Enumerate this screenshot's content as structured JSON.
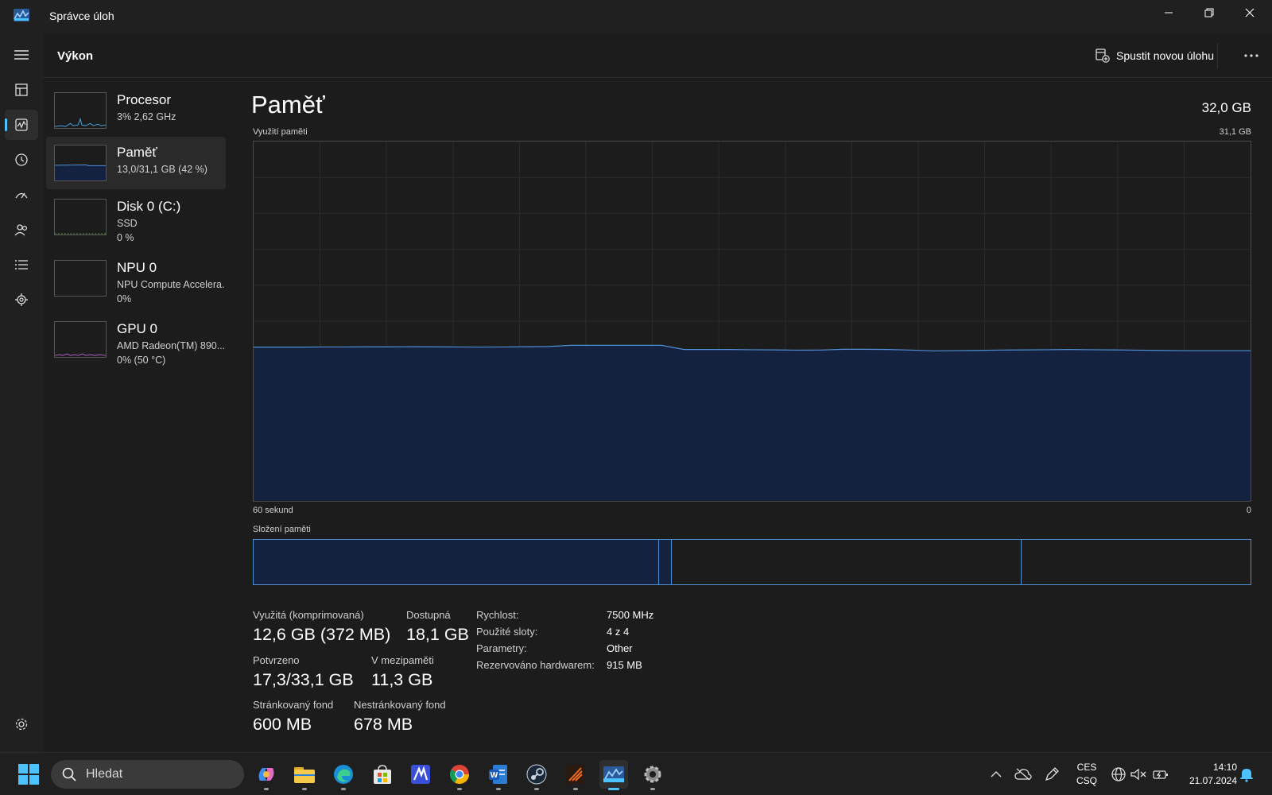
{
  "window": {
    "title": "Správce úloh"
  },
  "header": {
    "title": "Výkon",
    "run_task_label": "Spustit novou úlohu"
  },
  "resources": [
    {
      "name": "Procesor",
      "line1": "3%  2,62 GHz",
      "line2": ""
    },
    {
      "name": "Paměť",
      "line1": "13,0/31,1 GB (42 %)",
      "line2": ""
    },
    {
      "name": "Disk 0 (C:)",
      "line1": "SSD",
      "line2": "0 %"
    },
    {
      "name": "NPU 0",
      "line1": "NPU Compute Accelera.",
      "line2": "0%"
    },
    {
      "name": "GPU 0",
      "line1": "AMD Radeon(TM) 890...",
      "line2": "0%  (50 °C)"
    }
  ],
  "memory": {
    "title": "Paměť",
    "total": "32,0 GB",
    "usage_label": "Využití paměti",
    "usage_max": "31,1 GB",
    "time_left": "60 sekund",
    "time_right": "0",
    "composition_label": "Složení paměti",
    "composition_fractions": {
      "in_use": 0.407,
      "modified": 0.013,
      "standby": 0.351,
      "free": 0.229
    },
    "stats": {
      "used_label": "Využitá (komprimovaná)",
      "used_value": "12,6 GB (372 MB)",
      "available_label": "Dostupná",
      "available_value": "18,1 GB",
      "committed_label": "Potvrzeno",
      "committed_value": "17,3/33,1 GB",
      "cached_label": "V mezipaměti",
      "cached_value": "11,3 GB",
      "paged_label": "Stránkovaný fond",
      "paged_value": "600 MB",
      "nonpaged_label": "Nestránkovaný fond",
      "nonpaged_value": "678 MB"
    },
    "specs": {
      "speed_label": "Rychlost:",
      "speed_value": "7500 MHz",
      "slots_label": "Použité sloty:",
      "slots_value": "4 z 4",
      "form_label": "Parametry:",
      "form_value": "Other",
      "reserved_label": "Rezervováno hardwarem:",
      "reserved_value": "915 MB"
    }
  },
  "chart_data": {
    "type": "area",
    "title": "Využití paměti",
    "xlabel": "",
    "ylabel": "",
    "x_range_labels": [
      "60 sekund",
      "0"
    ],
    "ylim": [
      0,
      31.1
    ],
    "series": [
      {
        "values": [
          13.3,
          13.3,
          13.3,
          13.32,
          13.32,
          13.33,
          13.33,
          13.34,
          13.33,
          13.32,
          13.31,
          13.32,
          13.34,
          13.36,
          13.46,
          13.46,
          13.46,
          13.46,
          13.46,
          13.1,
          13.1,
          13.1,
          13.08,
          13.06,
          13.04,
          13.05,
          13.12,
          13.12,
          13.1,
          13.05,
          12.98,
          13.0,
          13.02,
          13.05,
          13.06,
          13.08,
          13.1,
          13.08,
          13.06,
          13.04,
          13.02,
          13.0,
          13.0,
          13.0,
          13.0
        ]
      }
    ],
    "colors": {
      "line": "#4d8fd4",
      "fill": "#14223f"
    }
  },
  "taskbar": {
    "search_placeholder": "Hledat",
    "apps": [
      "copilot-icon",
      "file-explorer-icon",
      "edge-icon",
      "store-icon",
      "code-editor-icon",
      "chrome-icon",
      "word-icon",
      "steam-icon",
      "app-icon",
      "task-manager-icon",
      "settings-icon"
    ],
    "lang_line1": "CES",
    "lang_line2": "CSQ",
    "time": "14:10",
    "date": "21.07.2024"
  }
}
